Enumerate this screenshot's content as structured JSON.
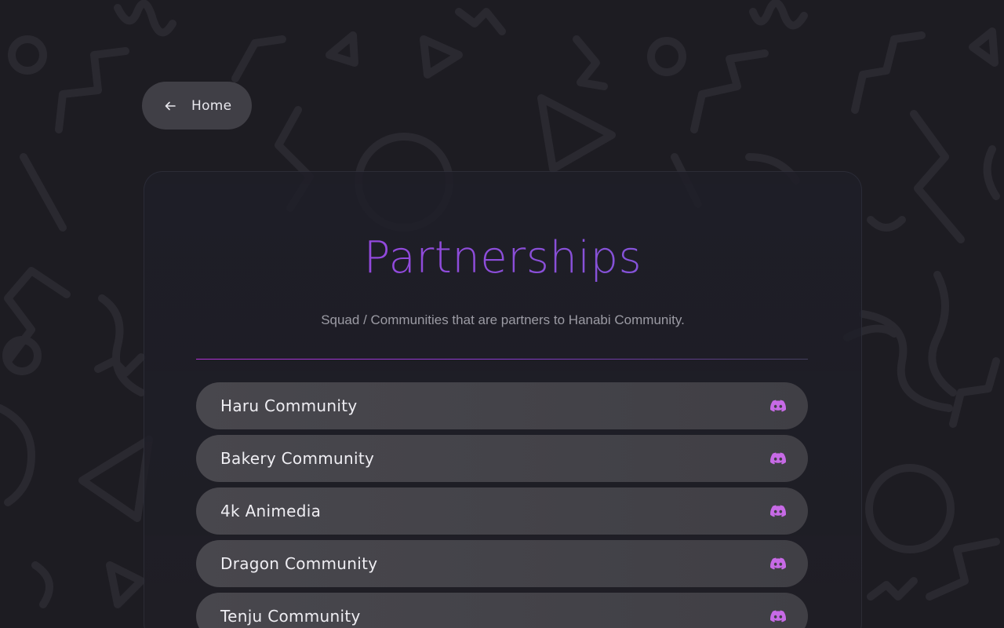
{
  "nav": {
    "home_label": "Home",
    "home_icon": "arrow-left-icon"
  },
  "header": {
    "title": "Partnerships",
    "subtitle": "Squad / Communities that are partners to Hanabi Community."
  },
  "colors": {
    "accent": "#a040e4",
    "discord_icon": "#c76ae6",
    "row_bg": "#48474d",
    "page_bg": "#1d1c22"
  },
  "partners": [
    {
      "name": "Haru Community",
      "icon": "discord-icon"
    },
    {
      "name": "Bakery Community",
      "icon": "discord-icon"
    },
    {
      "name": "4k Animedia",
      "icon": "discord-icon"
    },
    {
      "name": "Dragon Community",
      "icon": "discord-icon"
    },
    {
      "name": "Tenju Community",
      "icon": "discord-icon"
    }
  ]
}
